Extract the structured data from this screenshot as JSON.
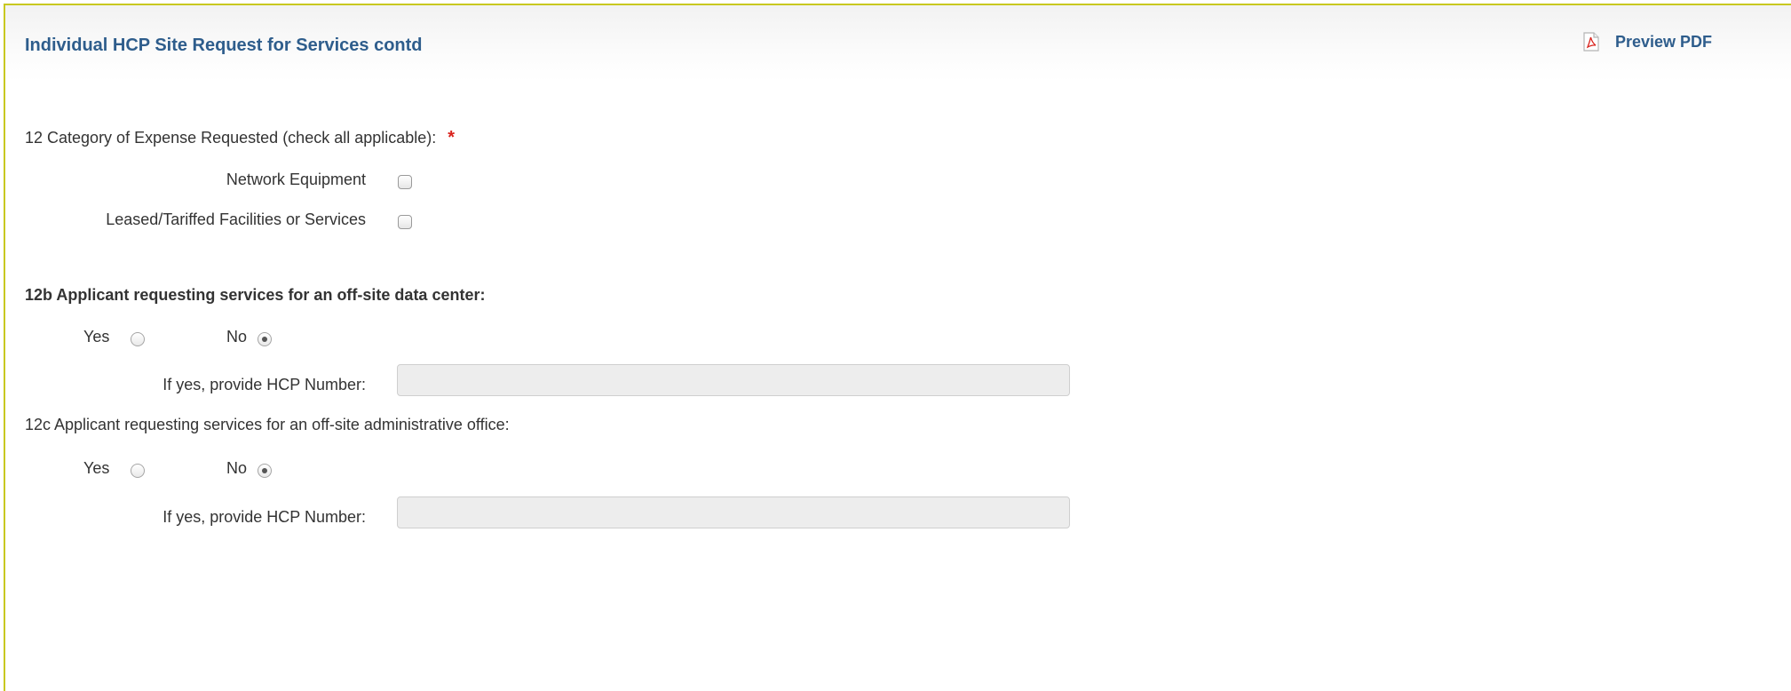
{
  "header": {
    "title": "Individual HCP Site Request for Services contd",
    "preview_pdf_label": "Preview PDF",
    "preview_pdf_icon": "pdf-icon"
  },
  "q12": {
    "label": "12 Category of Expense Requested (check all applicable):",
    "required_mark": "*",
    "options": [
      {
        "label": "Network Equipment",
        "checked": false
      },
      {
        "label": "Leased/Tariffed Facilities or Services",
        "checked": false
      }
    ]
  },
  "q12b": {
    "label": "12b Applicant requesting services for an off-site data center:",
    "yes_label": "Yes",
    "no_label": "No",
    "selected": "No",
    "hcp_label": "If yes, provide HCP Number:",
    "hcp_value": "",
    "hcp_placeholder": ""
  },
  "q12c": {
    "label": "12c Applicant requesting services for an off-site administrative office:",
    "yes_label": "Yes",
    "no_label": "No",
    "selected": "No",
    "hcp_label": "If yes, provide HCP Number:",
    "hcp_value": "",
    "hcp_placeholder": ""
  },
  "colors": {
    "title": "#2e5d8c",
    "required": "#d9221c",
    "border_accent": "#c8c820",
    "input_bg": "#ededed"
  }
}
